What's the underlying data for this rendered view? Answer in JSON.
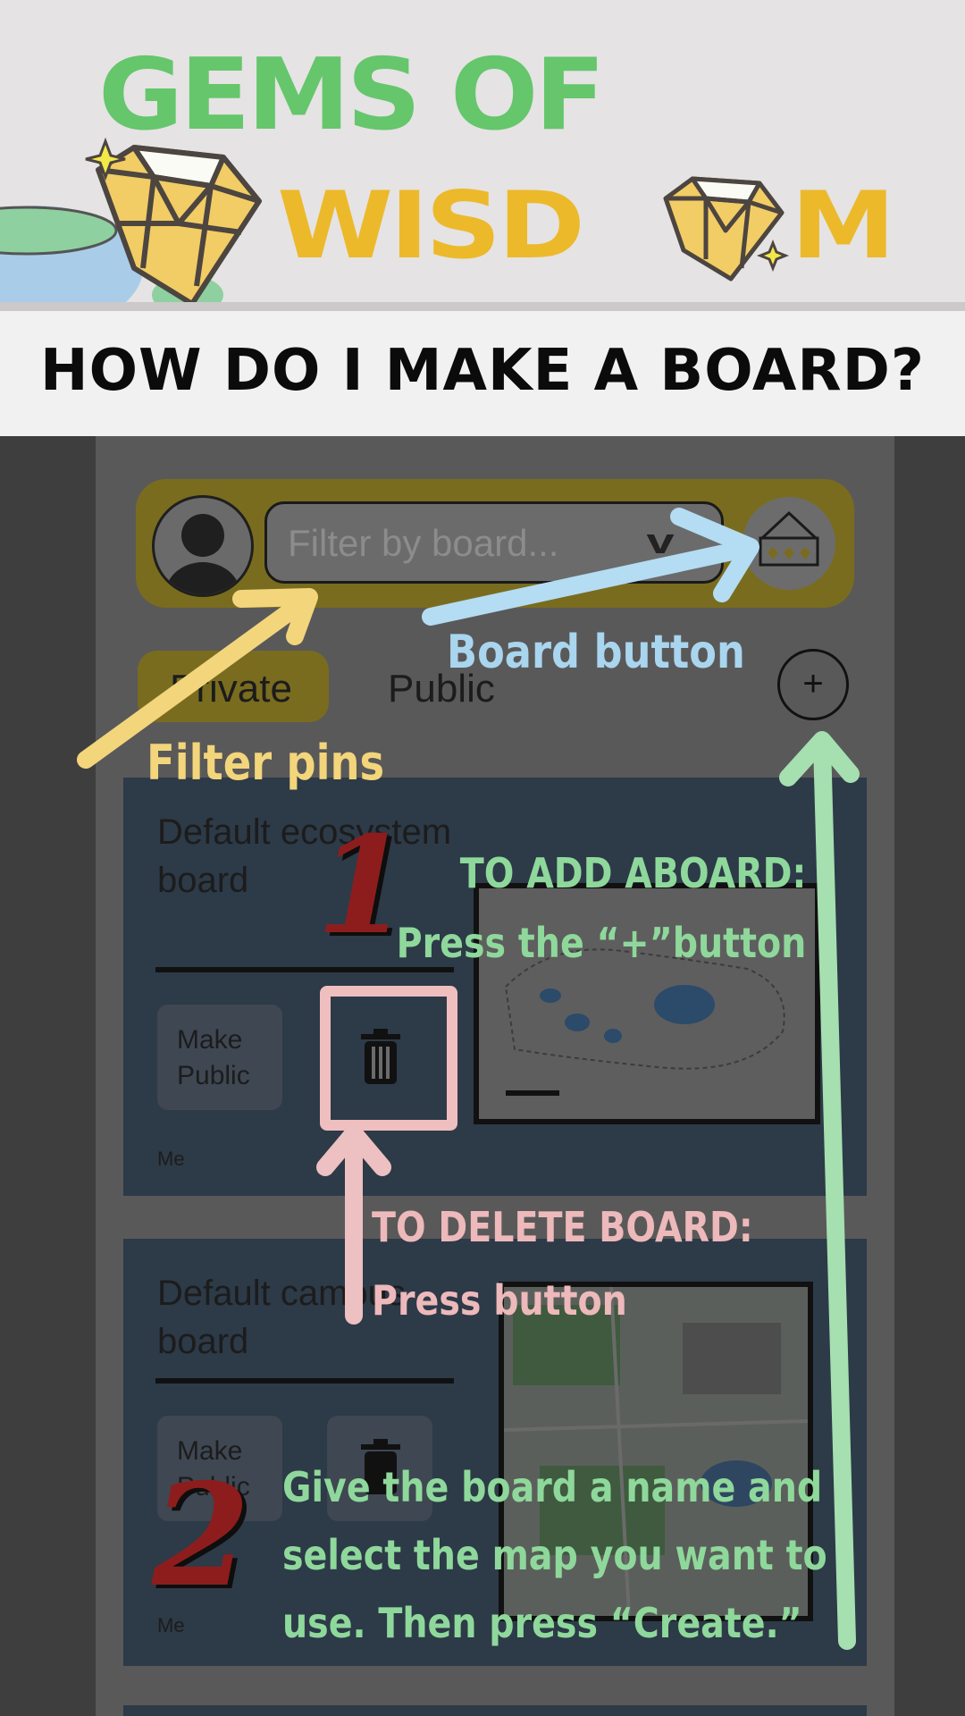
{
  "header": {
    "title_line1": "GEMS OF",
    "title_line2_left": "WISD",
    "title_line2_right": "M",
    "question": "HOW DO I MAKE A BOARD?"
  },
  "app": {
    "filter_placeholder": "Filter by board...",
    "filter_chevron": "v",
    "tabs": [
      "Private",
      "Public"
    ],
    "add_button_label": "+",
    "boards": [
      {
        "title": "Default ecosystem board",
        "make_public_label": "Make Public",
        "owner": "Me"
      },
      {
        "title": "Default campus board",
        "make_public_label": "Make Public",
        "owner": "Me"
      }
    ]
  },
  "annotations": {
    "board_button": "Board button",
    "filter_pins": "Filter pins",
    "add_board_line1": "TO ADD ABOARD:",
    "add_board_line2": "Press the “+”button",
    "delete_board_line1": "TO DELETE BOARD:",
    "delete_board_line2": "Press button",
    "step2_line1": "Give the board a name and",
    "step2_line2": "select the map you want to",
    "step2_line3": "use. Then press “Create.”",
    "step1_number": "1",
    "step2_number": "2"
  },
  "colors": {
    "green": "#8fd89b",
    "blue": "#a9d5ef",
    "yellow": "#f3d57b",
    "pink": "#edb9bb",
    "step_red": "#8d1d1d"
  },
  "icons": [
    "gem-icon",
    "sparkle-icon",
    "avatar-icon",
    "chevron-down-icon",
    "board-icon",
    "plus-icon",
    "trash-icon",
    "arrow-icon"
  ]
}
